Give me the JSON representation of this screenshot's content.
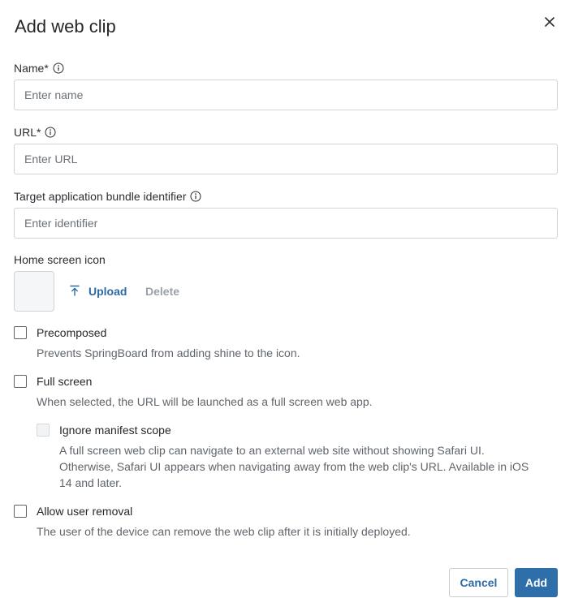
{
  "dialog": {
    "title": "Add web clip",
    "close_icon": "close-icon"
  },
  "fields": {
    "name": {
      "label": "Name*",
      "placeholder": "Enter name",
      "value": ""
    },
    "url": {
      "label": "URL*",
      "placeholder": "Enter URL",
      "value": ""
    },
    "bundle_id": {
      "label": "Target application bundle identifier",
      "placeholder": "Enter identifier",
      "value": ""
    }
  },
  "home_icon": {
    "label": "Home screen icon",
    "upload_label": "Upload",
    "delete_label": "Delete"
  },
  "options": {
    "precomposed": {
      "label": "Precomposed",
      "description": "Prevents SpringBoard from adding shine to the icon.",
      "checked": false
    },
    "full_screen": {
      "label": "Full screen",
      "description": "When selected, the URL will be launched as a full screen web app.",
      "checked": false
    },
    "ignore_manifest": {
      "label": "Ignore manifest scope",
      "description_line1": "A full screen web clip can navigate to an external web site without showing Safari UI.",
      "description_line2": "Otherwise, Safari UI appears when navigating away from the web clip's URL. Available in iOS",
      "description_line3": "14 and later.",
      "checked": false,
      "disabled": true
    },
    "allow_removal": {
      "label": "Allow user removal",
      "description": "The user of the device can remove the web clip after it is initially deployed.",
      "checked": false
    }
  },
  "footer": {
    "cancel_label": "Cancel",
    "add_label": "Add"
  },
  "colors": {
    "accent": "#2f6fa9",
    "link": "#2c6aa5",
    "muted": "#9aa1a8",
    "border": "#cfd4d9"
  }
}
